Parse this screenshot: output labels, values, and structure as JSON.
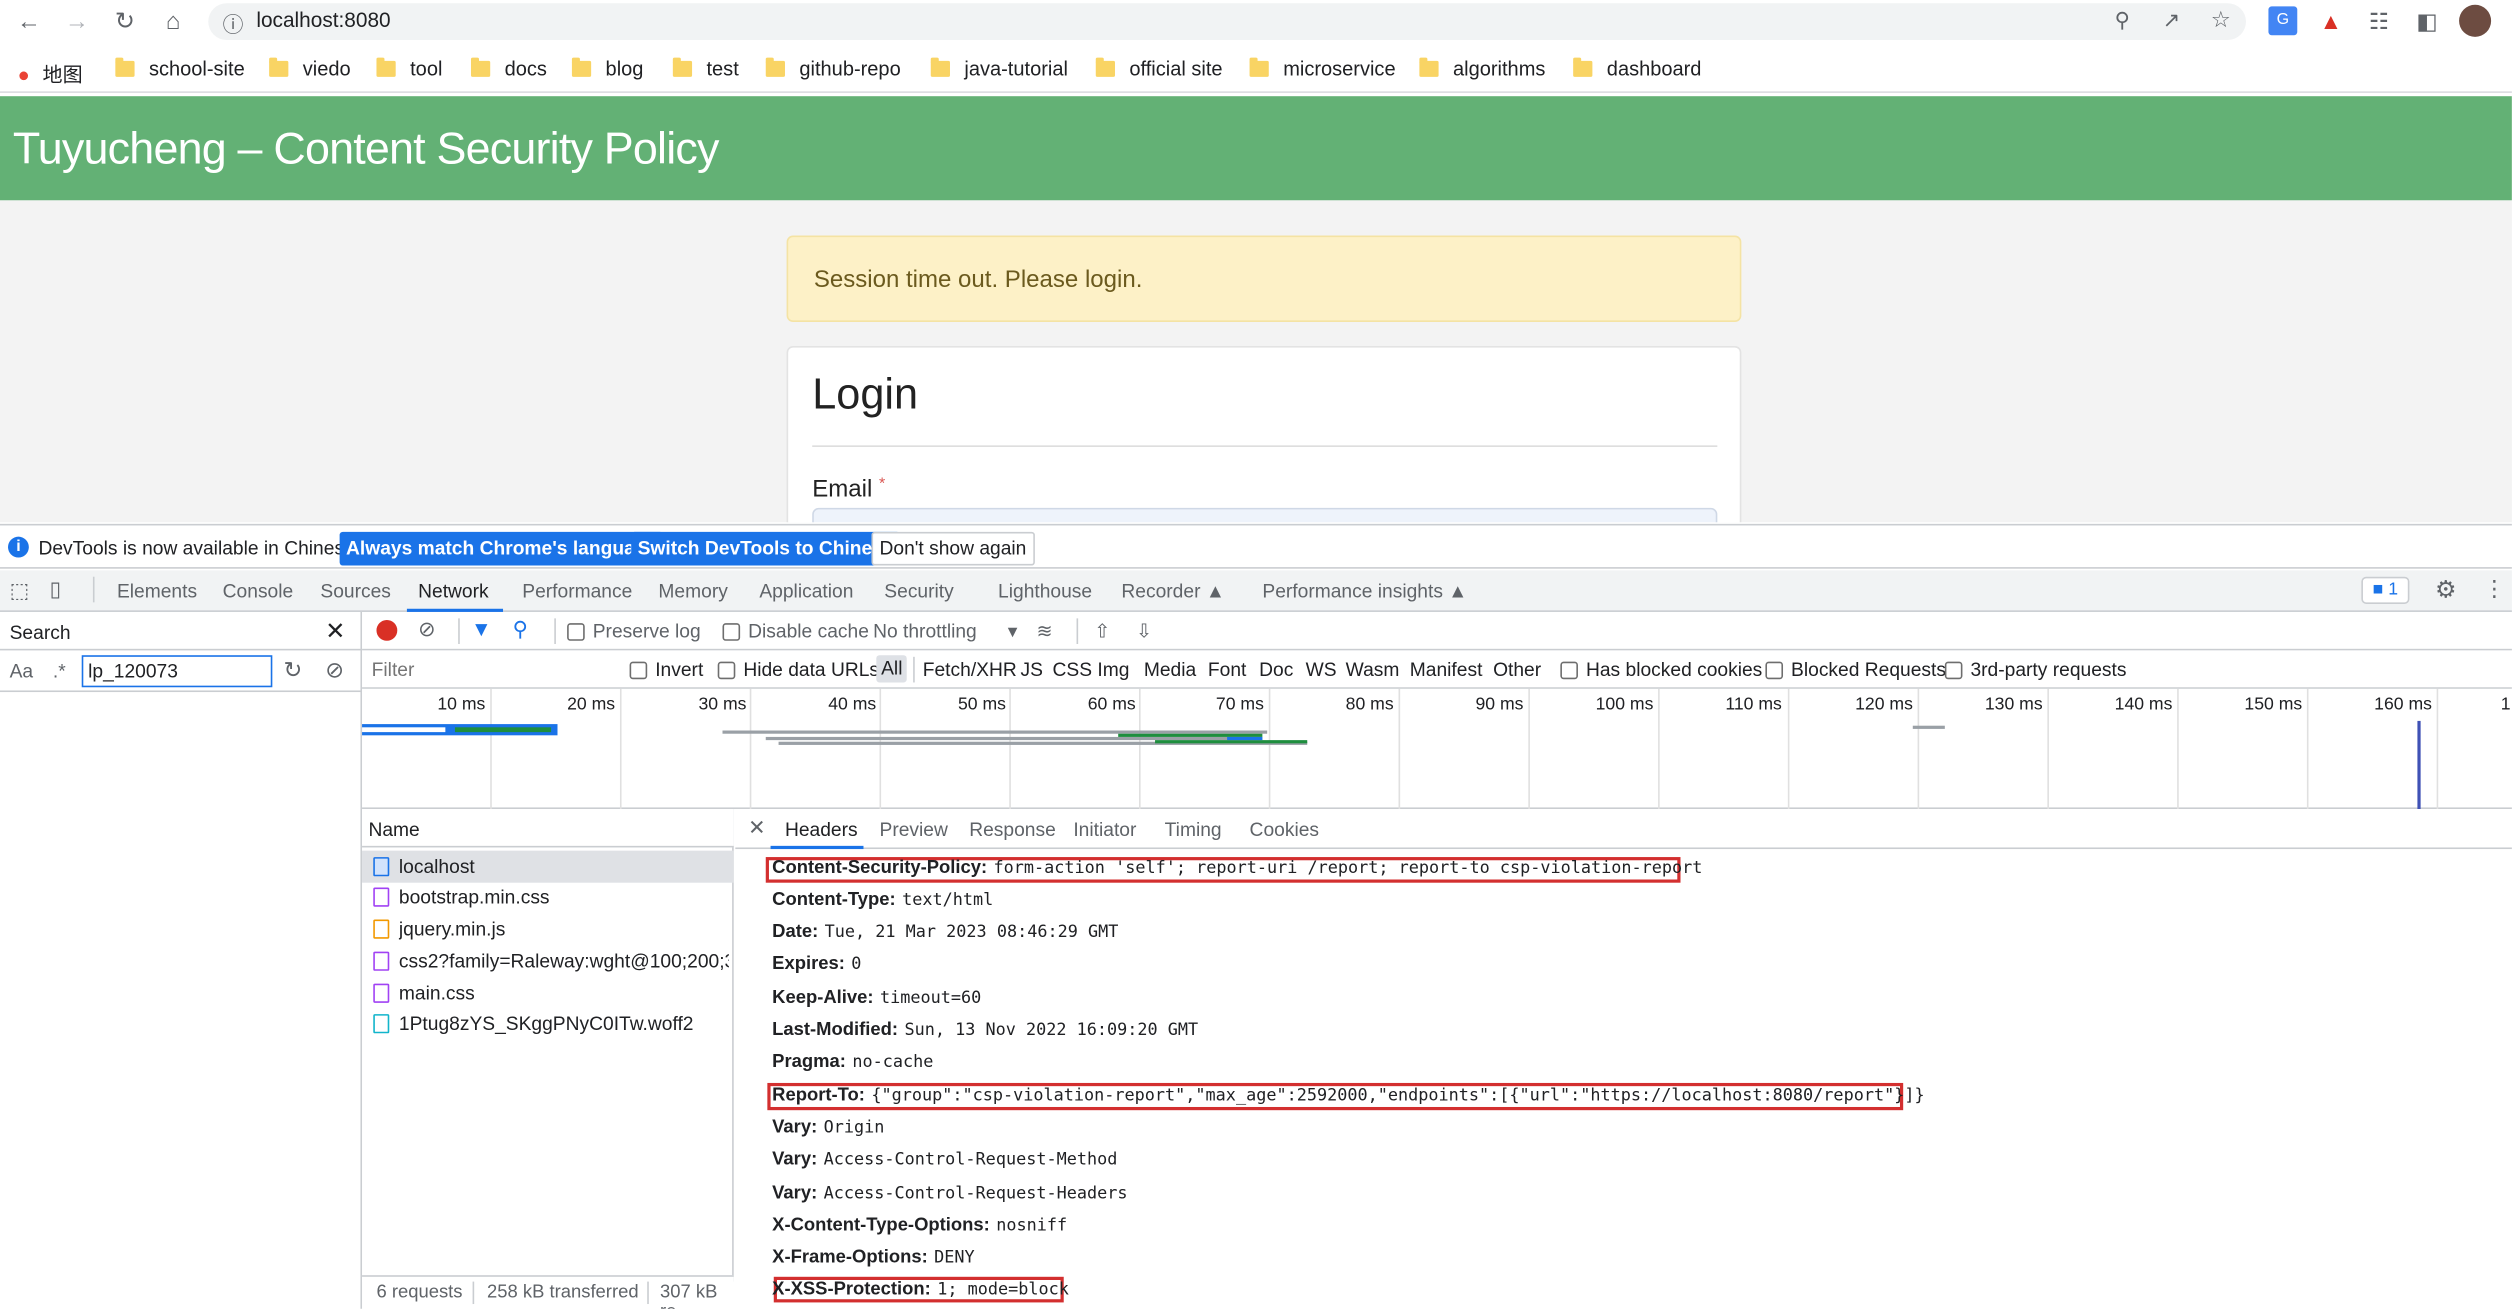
{
  "browser": {
    "url": "localhost:8080",
    "bookmarks": [
      {
        "label": "地图"
      },
      {
        "label": "school-site"
      },
      {
        "label": "viedo"
      },
      {
        "label": "tool"
      },
      {
        "label": "docs"
      },
      {
        "label": "blog"
      },
      {
        "label": "test"
      },
      {
        "label": "github-repo"
      },
      {
        "label": "java-tutorial"
      },
      {
        "label": "official site"
      },
      {
        "label": "microservice"
      },
      {
        "label": "algorithms"
      },
      {
        "label": "dashboard"
      }
    ]
  },
  "page": {
    "title": "Tuyucheng – Content Security Policy",
    "alert": "Session time out. Please login.",
    "login_title": "Login",
    "email_label": "Email",
    "required_mark": "*",
    "banner_color": "#63b175"
  },
  "devtools": {
    "infobar": {
      "text": "DevTools is now available in Chinese!",
      "btn_match": "Always match Chrome's language",
      "btn_switch": "Switch DevTools to Chinese",
      "btn_dismiss": "Don't show again"
    },
    "tabs": [
      "Elements",
      "Console",
      "Sources",
      "Network",
      "Performance",
      "Memory",
      "Application",
      "Security",
      "Lighthouse",
      "Recorder",
      "Performance insights"
    ],
    "active_tab": "Network",
    "issues_count": "1",
    "search": {
      "title": "Search",
      "case_toggle": "Aa",
      "regex_toggle": ".*",
      "query": "lp_120073"
    },
    "network_toolbar": {
      "preserve_log": "Preserve log",
      "disable_cache": "Disable cache",
      "throttling": "No throttling"
    },
    "filter_bar": {
      "placeholder": "Filter",
      "invert": "Invert",
      "hide_data_urls": "Hide data URLs",
      "types": [
        "All",
        "Fetch/XHR",
        "JS",
        "CSS",
        "Img",
        "Media",
        "Font",
        "Doc",
        "WS",
        "Wasm",
        "Manifest",
        "Other"
      ],
      "has_blocked_cookies": "Has blocked cookies",
      "blocked_requests": "Blocked Requests",
      "third_party": "3rd-party requests"
    },
    "timeline_ticks": [
      "10 ms",
      "20 ms",
      "30 ms",
      "40 ms",
      "50 ms",
      "60 ms",
      "70 ms",
      "80 ms",
      "90 ms",
      "100 ms",
      "110 ms",
      "120 ms",
      "130 ms",
      "140 ms",
      "150 ms",
      "160 ms",
      "1"
    ],
    "request_list": {
      "column": "Name",
      "rows": [
        {
          "name": "localhost",
          "icon": "document-icon"
        },
        {
          "name": "bootstrap.min.css",
          "icon": "stylesheet-icon"
        },
        {
          "name": "jquery.min.js",
          "icon": "script-icon"
        },
        {
          "name": "css2?family=Raleway:wght@100;200;30...",
          "icon": "stylesheet-icon"
        },
        {
          "name": "main.css",
          "icon": "stylesheet-icon"
        },
        {
          "name": "1Ptug8zYS_SKggPNyC0ITw.woff2",
          "icon": "font-icon"
        }
      ]
    },
    "status": {
      "requests": "6 requests",
      "transferred": "258 kB transferred",
      "resources": "307 kB re"
    },
    "details": {
      "tabs": [
        "Headers",
        "Preview",
        "Response",
        "Initiator",
        "Timing",
        "Cookies"
      ],
      "active_tab": "Headers",
      "headers": [
        {
          "name": "Content-Security-Policy:",
          "value": "form-action 'self'; report-uri /report; report-to csp-violation-report",
          "highlighted": true
        },
        {
          "name": "Content-Type:",
          "value": "text/html",
          "highlighted": false
        },
        {
          "name": "Date:",
          "value": "Tue, 21 Mar 2023 08:46:29 GMT",
          "highlighted": false
        },
        {
          "name": "Expires:",
          "value": "0",
          "highlighted": false
        },
        {
          "name": "Keep-Alive:",
          "value": "timeout=60",
          "highlighted": false
        },
        {
          "name": "Last-Modified:",
          "value": "Sun, 13 Nov 2022 16:09:20 GMT",
          "highlighted": false
        },
        {
          "name": "Pragma:",
          "value": "no-cache",
          "highlighted": false
        },
        {
          "name": "Report-To:",
          "value": "{\"group\":\"csp-violation-report\",\"max_age\":2592000,\"endpoints\":[{\"url\":\"https://localhost:8080/report\"}]}",
          "highlighted": true
        },
        {
          "name": "Vary:",
          "value": "Origin",
          "highlighted": false
        },
        {
          "name": "Vary:",
          "value": "Access-Control-Request-Method",
          "highlighted": false
        },
        {
          "name": "Vary:",
          "value": "Access-Control-Request-Headers",
          "highlighted": false
        },
        {
          "name": "X-Content-Type-Options:",
          "value": "nosniff",
          "highlighted": false
        },
        {
          "name": "X-Frame-Options:",
          "value": "DENY",
          "highlighted": false
        },
        {
          "name": "X-XSS-Protection:",
          "value": "1; mode=block",
          "highlighted": true
        }
      ]
    }
  }
}
